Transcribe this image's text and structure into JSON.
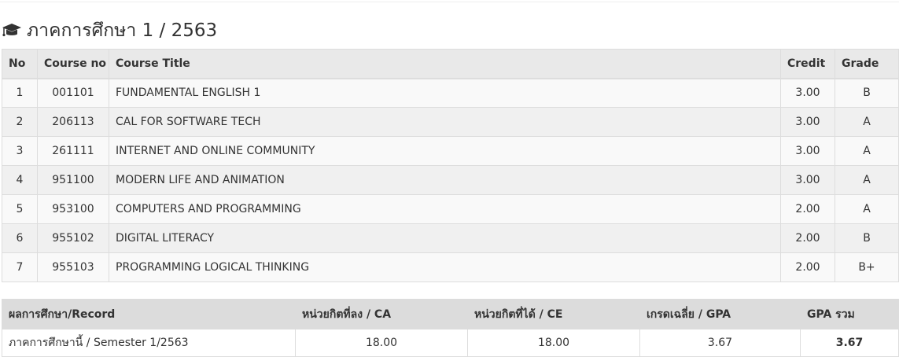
{
  "semester": {
    "title": "ภาคการศึกษา 1 / 2563",
    "icon": "graduation-cap-icon"
  },
  "courses": {
    "headers": {
      "no": "No",
      "course_no": "Course no",
      "title": "Course Title",
      "credit": "Credit",
      "grade": "Grade"
    },
    "rows": [
      {
        "no": "1",
        "course_no": "001101",
        "title": "FUNDAMENTAL ENGLISH 1",
        "credit": "3.00",
        "grade": "B"
      },
      {
        "no": "2",
        "course_no": "206113",
        "title": "CAL FOR SOFTWARE TECH",
        "credit": "3.00",
        "grade": "A"
      },
      {
        "no": "3",
        "course_no": "261111",
        "title": "INTERNET AND ONLINE COMMUNITY",
        "credit": "3.00",
        "grade": "A"
      },
      {
        "no": "4",
        "course_no": "951100",
        "title": "MODERN LIFE AND ANIMATION",
        "credit": "3.00",
        "grade": "A"
      },
      {
        "no": "5",
        "course_no": "953100",
        "title": "COMPUTERS AND PROGRAMMING",
        "credit": "2.00",
        "grade": "A"
      },
      {
        "no": "6",
        "course_no": "955102",
        "title": "DIGITAL LITERACY",
        "credit": "2.00",
        "grade": "B"
      },
      {
        "no": "7",
        "course_no": "955103",
        "title": "PROGRAMMING LOGICAL THINKING",
        "credit": "2.00",
        "grade": "B+"
      }
    ]
  },
  "summary": {
    "headers": {
      "record": "ผลการศึกษา/Record",
      "ca": "หน่วยกิตที่ลง / CA",
      "ce": "หน่วยกิตที่ได้ / CE",
      "gpa": "เกรดเฉลี่ย / GPA",
      "gpax": "GPA รวม"
    },
    "row": {
      "label": "ภาคการศึกษานี้ / Semester 1/2563",
      "ca": "18.00",
      "ce": "18.00",
      "gpa": "3.67",
      "gpax": "3.67"
    }
  }
}
